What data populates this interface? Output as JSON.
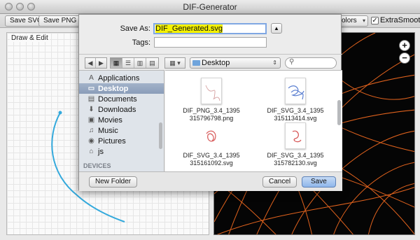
{
  "app": {
    "title": "DIF-Generator"
  },
  "toolbar": {
    "save_svg": "Save SVG",
    "save_png": "Save PNG",
    "colors_value": "colors",
    "extrasmooth_label": "ExtraSmooth",
    "extrasmooth_checked": true
  },
  "left_panel": {
    "label": "Draw & Edit"
  },
  "right_panel": {
    "zoom_in": "+",
    "zoom_out": "−"
  },
  "dialog": {
    "save_as_label": "Save As:",
    "save_as_value": "DIF_Generated.svg",
    "tags_label": "Tags:",
    "tags_value": "",
    "location": "Desktop",
    "view_modes": [
      "icons",
      "list",
      "columns",
      "cover-flow"
    ],
    "sidebar": {
      "items": [
        {
          "label": "Applications",
          "icon": "applications-icon"
        },
        {
          "label": "Desktop",
          "icon": "desktop-icon",
          "selected": true
        },
        {
          "label": "Documents",
          "icon": "documents-icon"
        },
        {
          "label": "Downloads",
          "icon": "downloads-icon"
        },
        {
          "label": "Movies",
          "icon": "movies-icon"
        },
        {
          "label": "Music",
          "icon": "music-icon"
        },
        {
          "label": "Pictures",
          "icon": "pictures-icon"
        },
        {
          "label": "js",
          "icon": "home-icon"
        }
      ],
      "devices_header": "DEVICES"
    },
    "files": [
      {
        "line1": "DIF_PNG_3.4_1395",
        "line2": "315796798.png",
        "color": "#d8a7a7"
      },
      {
        "line1": "DIF_SVG_3.4_1395",
        "line2": "315113414.svg",
        "color": "#5b7fd1"
      },
      {
        "line1": "DIF_SVG_3.4_1395",
        "line2": "315161092.svg",
        "color": "#d85b5b"
      },
      {
        "line1": "DIF_SVG_3.4_1395",
        "line2": "315782130.svg",
        "color": "#d65252"
      }
    ],
    "new_folder": "New Folder",
    "cancel": "Cancel",
    "save": "Save"
  }
}
